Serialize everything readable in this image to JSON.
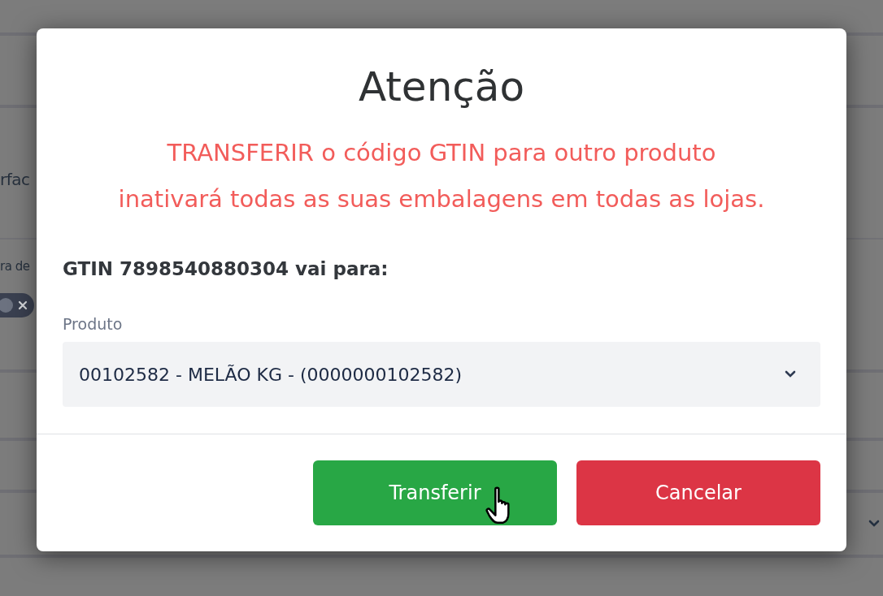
{
  "background": {
    "texts": [
      "rfac",
      "ra de"
    ],
    "chip": {
      "removable": true
    }
  },
  "dialog": {
    "title": "Atenção",
    "warning": [
      "TRANSFERIR o código GTIN para outro produto",
      "inativará todas as suas embalagens em todas as lojas."
    ],
    "subject": "GTIN 7898540880304 vai para:",
    "field": {
      "label": "Produto",
      "value": "00102582 - MELÃO KG - (0000000102582)"
    },
    "buttons": [
      {
        "label": "Transferir",
        "kind": "confirm"
      },
      {
        "label": "Cancelar",
        "kind": "cancel"
      }
    ]
  }
}
